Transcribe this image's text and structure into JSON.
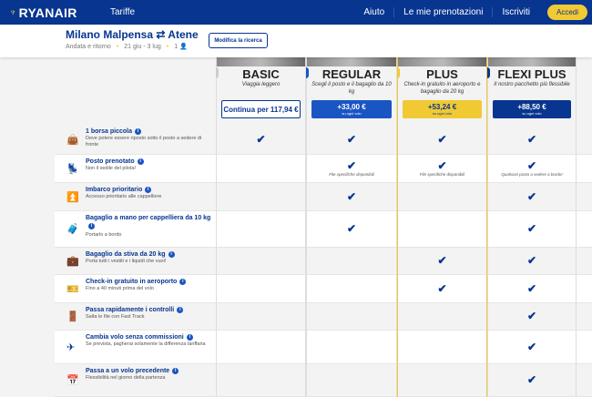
{
  "header": {
    "logo": "RYANAIR",
    "tariffe": "Tariffe",
    "nav": [
      "Aiuto",
      "Le mie prenotazioni",
      "Iscriviti"
    ],
    "login": "Accedi"
  },
  "search": {
    "route": "Milano Malpensa ⇄ Atene",
    "trip": "Andata e ritorno",
    "dates": "21 giu - 3 lug",
    "passengers": "1",
    "modify": "Modifica la ricerca"
  },
  "colors": {
    "brand": "#073590",
    "accent": "#f1c933"
  },
  "fares": [
    {
      "name": "BASIC",
      "tagline": "Viaggia leggero",
      "price": "Continua per 117,94 €",
      "sub": ""
    },
    {
      "name": "REGULAR",
      "tagline": "Scegli il posto e il bagaglio da 10 kg",
      "price": "+33,00 €",
      "sub": "su ogni volo"
    },
    {
      "name": "PLUS",
      "tagline": "Check-in gratuito in aeroporto e bagaglio da 20 kg",
      "price": "+53,24 €",
      "sub": "su ogni volo"
    },
    {
      "name": "FLEXI PLUS",
      "tagline": "Il nostro pacchetto più flessibile",
      "price": "+88,50 €",
      "sub": "su ogni volo"
    }
  ],
  "features": [
    {
      "icon": "small-bag-icon",
      "title": "1 borsa piccola",
      "desc": "Deve potere essere riposto sotto il posto a sedere di fronte",
      "included": [
        true,
        true,
        true,
        true
      ],
      "notes": [
        "",
        "",
        "",
        ""
      ]
    },
    {
      "icon": "seat-icon",
      "title": "Posto prenotato",
      "desc": "Non il sedile del pilota!",
      "included": [
        false,
        true,
        true,
        true
      ],
      "notes": [
        "",
        "File specifiche disponibili",
        "File specifiche disponibili",
        "Qualsiasi posto a sedere a bordo!"
      ]
    },
    {
      "icon": "priority-icon",
      "title": "Imbarco prioritario",
      "desc": "Accesso prioritario alle cappelliere",
      "included": [
        false,
        true,
        false,
        true
      ],
      "notes": [
        "",
        "",
        "",
        ""
      ]
    },
    {
      "icon": "cabin-bag-icon",
      "title": "Bagaglio a mano per cappelliera da 10 kg",
      "desc": "Portarlo a bordo",
      "included": [
        false,
        true,
        false,
        true
      ],
      "notes": [
        "",
        "",
        "",
        ""
      ]
    },
    {
      "icon": "checked-bag-icon",
      "title": "Bagaglio da stiva da 20 kg",
      "desc": "Porta tutti i vestiti e i liquidi che vuoi!",
      "included": [
        false,
        false,
        true,
        true
      ],
      "notes": [
        "",
        "",
        "",
        ""
      ]
    },
    {
      "icon": "checkin-icon",
      "title": "Check-in gratuito in aeroporto",
      "desc": "Fino a 40 minuti prima del volo",
      "included": [
        false,
        false,
        true,
        true
      ],
      "notes": [
        "",
        "",
        "",
        ""
      ]
    },
    {
      "icon": "fast-track-icon",
      "title": "Passa rapidamente i controlli",
      "desc": "Salta le file con Fast Track",
      "included": [
        false,
        false,
        false,
        true
      ],
      "notes": [
        "",
        "",
        "",
        ""
      ]
    },
    {
      "icon": "flight-change-icon",
      "title": "Cambia volo senza commissioni",
      "desc": "Se prevista, pagherai solamente la differenza tariffaria",
      "included": [
        false,
        false,
        false,
        true
      ],
      "notes": [
        "",
        "",
        "",
        ""
      ]
    },
    {
      "icon": "calendar-icon",
      "title": "Passa a un volo precedente",
      "desc": "Flessibilità nel giorno della partenza",
      "included": [
        false,
        false,
        false,
        true
      ],
      "notes": [
        "",
        "",
        "",
        ""
      ]
    }
  ]
}
